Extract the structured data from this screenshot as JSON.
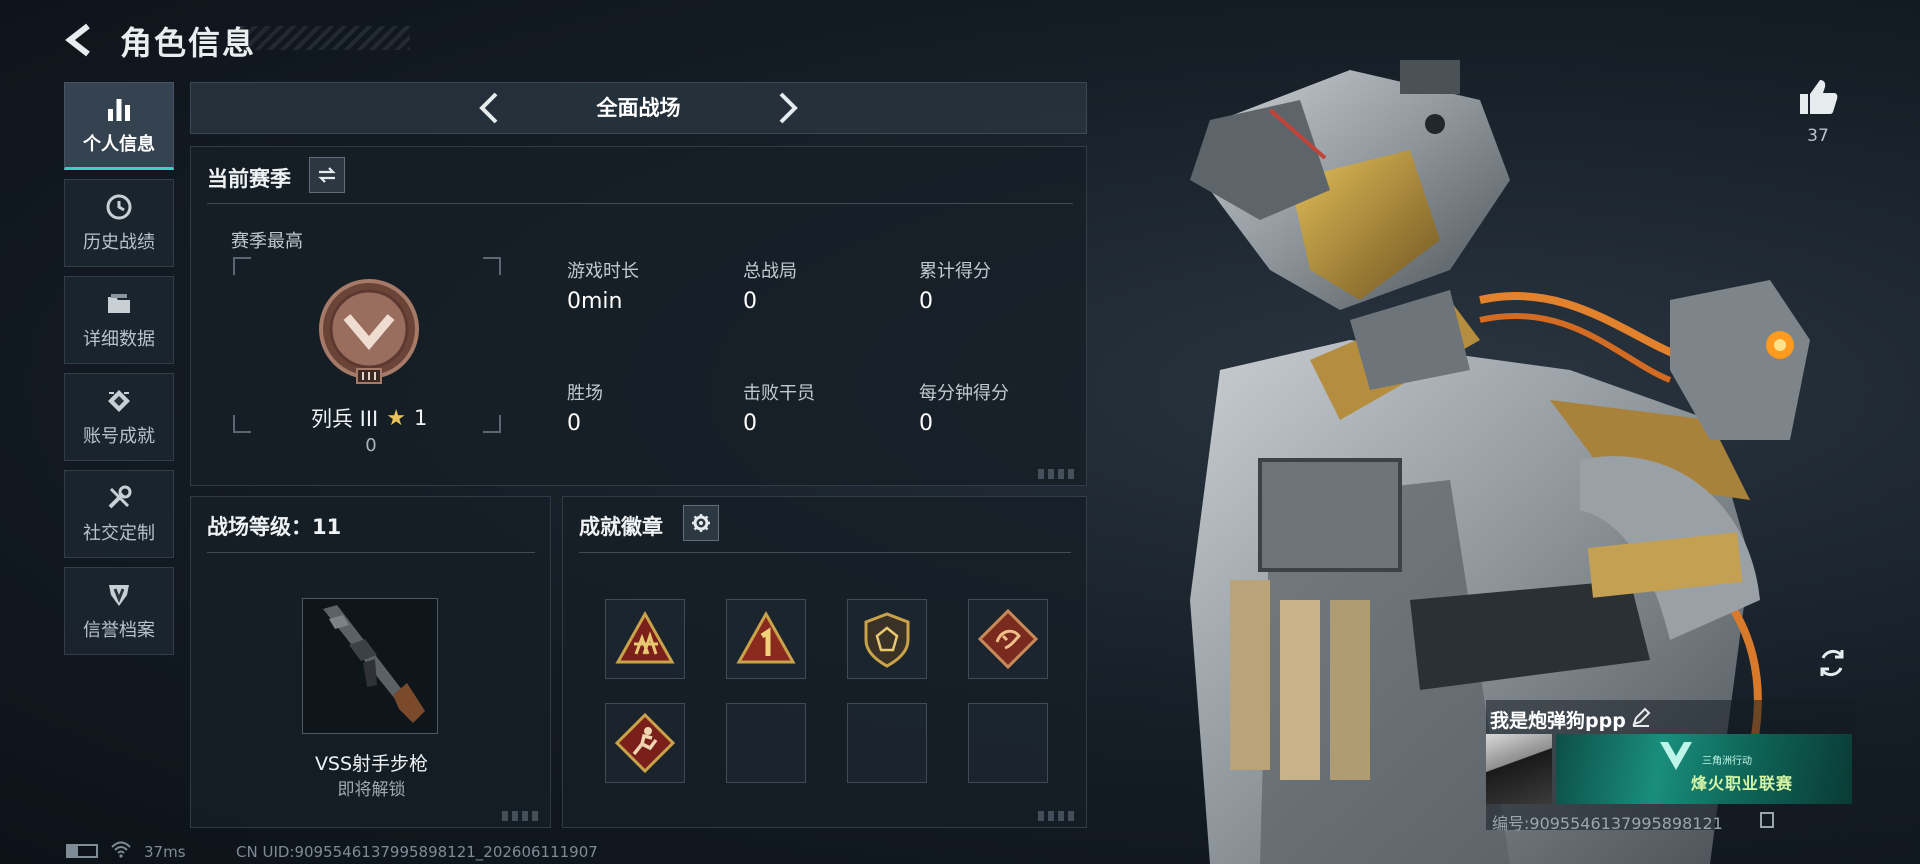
{
  "header": {
    "title": "角色信息"
  },
  "sidebar": {
    "items": [
      {
        "label": "个人信息",
        "icon": "bar-chart-icon",
        "active": true
      },
      {
        "label": "历史战绩",
        "icon": "history-clock-icon",
        "active": false
      },
      {
        "label": "详细数据",
        "icon": "folder-icon",
        "active": false
      },
      {
        "label": "账号成就",
        "icon": "achievement-emblem-icon",
        "active": false
      },
      {
        "label": "社交定制",
        "icon": "tools-icon",
        "active": false
      },
      {
        "label": "信誉档案",
        "icon": "shield-emblem-icon",
        "active": false
      }
    ]
  },
  "mode": {
    "title": "全面战场"
  },
  "season": {
    "title": "当前赛季",
    "best_label": "赛季最高",
    "rank_name": "列兵 III",
    "stars": "1",
    "rank_points": "0",
    "stats": [
      {
        "label": "游戏时长",
        "value": "0min"
      },
      {
        "label": "总战局",
        "value": "0"
      },
      {
        "label": "累计得分",
        "value": "0"
      },
      {
        "label": "胜场",
        "value": "0"
      },
      {
        "label": "击败干员",
        "value": "0"
      },
      {
        "label": "每分钟得分",
        "value": "0"
      }
    ]
  },
  "level": {
    "title": "战场等级：11",
    "weapon_name": "VSS射手步枪",
    "weapon_status": "即将解锁"
  },
  "badges": {
    "title": "成就徽章",
    "slots": [
      {
        "icon": "soldiers-triangle-badge-icon",
        "filled": true
      },
      {
        "icon": "number-one-triangle-badge-icon",
        "filled": true
      },
      {
        "icon": "shield-emblem-badge-icon",
        "filled": true
      },
      {
        "icon": "dragon-diamond-badge-icon",
        "filled": true
      },
      {
        "icon": "runner-diamond-badge-icon",
        "filled": true
      },
      {
        "icon": "empty-slot",
        "filled": false
      },
      {
        "icon": "empty-slot",
        "filled": false
      },
      {
        "icon": "empty-slot",
        "filled": false
      }
    ]
  },
  "status_bar": {
    "ping": "37ms",
    "uid": "CN UID:9095546137995898121_202606111907"
  },
  "profile": {
    "likes": "37",
    "player_name": "我是炮弹狗ppp",
    "player_id": "编号:9095546137995898121",
    "banner_text": "烽火职业联赛",
    "banner_small": "三角洲行动"
  },
  "colors": {
    "accent": "#2fd6c3",
    "rank_bronze": "#8a5a48",
    "badge_gold": "#c9a24a",
    "badge_red": "#7a1f1a"
  }
}
